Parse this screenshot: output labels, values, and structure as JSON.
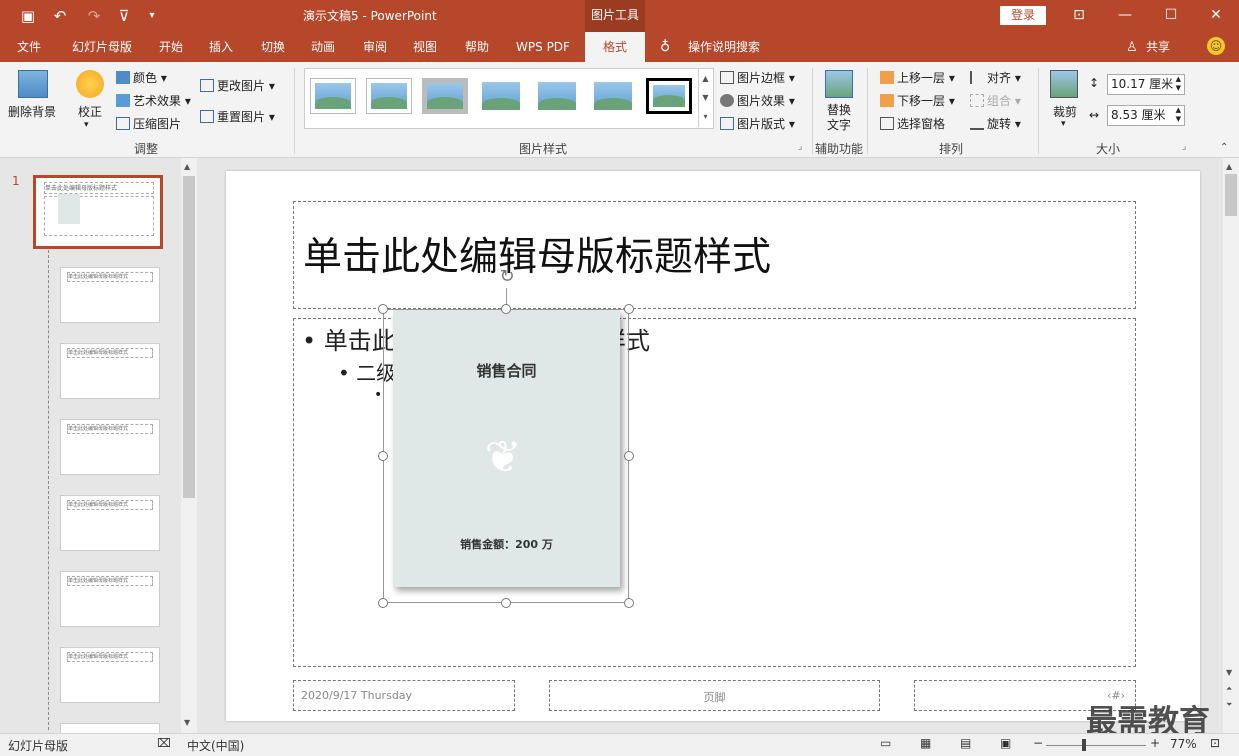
{
  "titlebar": {
    "doc_title": "演示文稿5 - PowerPoint",
    "context_tab": "图片工具",
    "login": "登录"
  },
  "tabs": [
    "文件",
    "幻灯片母版",
    "开始",
    "插入",
    "切换",
    "动画",
    "审阅",
    "视图",
    "帮助",
    "WPS PDF",
    "格式"
  ],
  "search_tell": "操作说明搜索",
  "share": "共享",
  "ribbon": {
    "remove_bg": "删除背景",
    "correct": "校正",
    "color": "颜色",
    "art_effect": "艺术效果",
    "compress": "压缩图片",
    "change_pic": "更改图片",
    "reset_pic": "重置图片",
    "group_adjust": "调整",
    "border": "图片边框",
    "effect": "图片效果",
    "layout": "图片版式",
    "group_styles": "图片样式",
    "alt_text": "替换文字",
    "group_access": "辅助功能",
    "bring_forward": "上移一层",
    "send_backward": "下移一层",
    "selection_pane": "选择窗格",
    "align": "对齐",
    "group_obj": "组合",
    "rotate": "旋转",
    "group_arrange": "排列",
    "crop": "裁剪",
    "height": "10.17 厘米",
    "width": "8.53 厘米",
    "group_size": "大小"
  },
  "thumbnails": {
    "selected_index": "1",
    "title_text": "单击此处编辑母版标题样式"
  },
  "slide": {
    "title": "单击此处编辑母版标题样式",
    "bullet1": "单击此",
    "bullet1b": "样式",
    "bullet2": "二级",
    "date": "2020/9/17 Thursday",
    "footer": "页脚",
    "page_num": "‹#›"
  },
  "picture": {
    "heading": "销售合同",
    "amount": "销售金额：200 万"
  },
  "status": {
    "view": "幻灯片母版",
    "lang": "中文(中国)",
    "zoom": "77%"
  },
  "watermark": "最需教育"
}
